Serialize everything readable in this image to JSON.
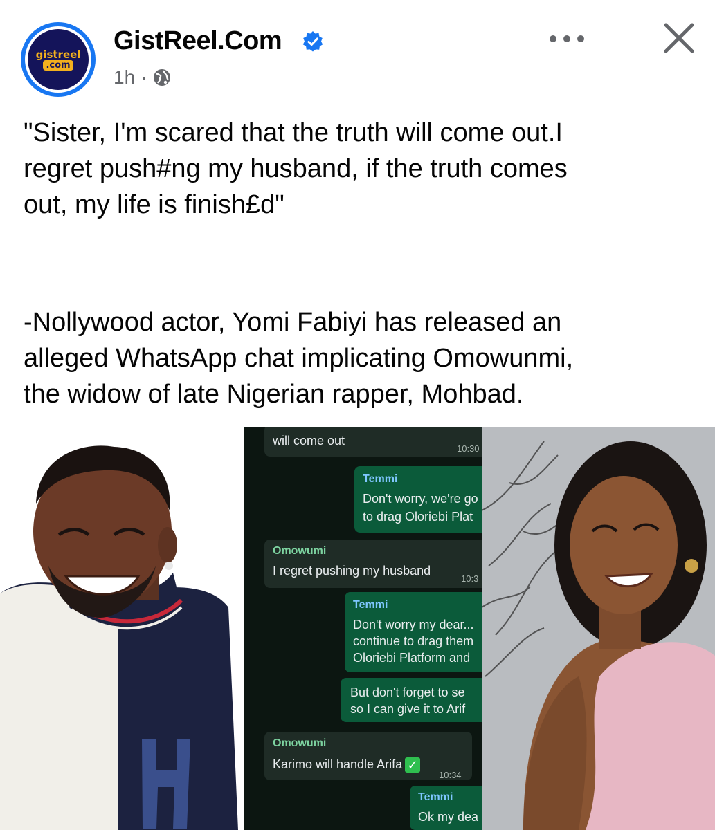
{
  "header": {
    "avatar_text_line1": "gistreel",
    "avatar_text_line2": ".com",
    "page_name": "GistReel.Com",
    "time": "1h",
    "separator": "·"
  },
  "post": {
    "quote_lines": [
      "\"Sister, I'm scared that the truth will come out.I",
      "regret push#ng my husband, if the truth comes",
      "out, my life is finish£d\""
    ],
    "body_lines": [
      "-Nollywood actor, Yomi Fabiyi has released an",
      "alleged WhatsApp chat implicating Omowunmi,",
      "the widow of late Nigerian rapper, Mohbad."
    ]
  },
  "chat": {
    "m1": {
      "text": "will come out",
      "time": "10:30"
    },
    "m2": {
      "sender": "Temmi",
      "line1": "Don't worry, we're go",
      "line2": "to drag Oloriebi Plat"
    },
    "m3": {
      "sender": "Omowumi",
      "text": "I regret pushing my husband",
      "time": "10:3"
    },
    "m4": {
      "sender": "Temmi",
      "line1": "Don't worry my dear...",
      "line2": "continue to drag them",
      "line3": "Oloriebi Platform and"
    },
    "m5": {
      "line1": "But don't forget to se",
      "line2": "so I can give it to Arif"
    },
    "m6": {
      "sender": "Omowumi",
      "text": "Karimo will handle Arifa",
      "time": "10:34"
    },
    "m7": {
      "sender": "Temmi",
      "text": "Ok my dea"
    }
  },
  "colors": {
    "verified": "#1877f2",
    "meta_gray": "#65676b",
    "chat_bg": "#0c1611",
    "incoming_bubble": "#1f2c26",
    "outgoing_bubble": "#0b5b3a"
  }
}
